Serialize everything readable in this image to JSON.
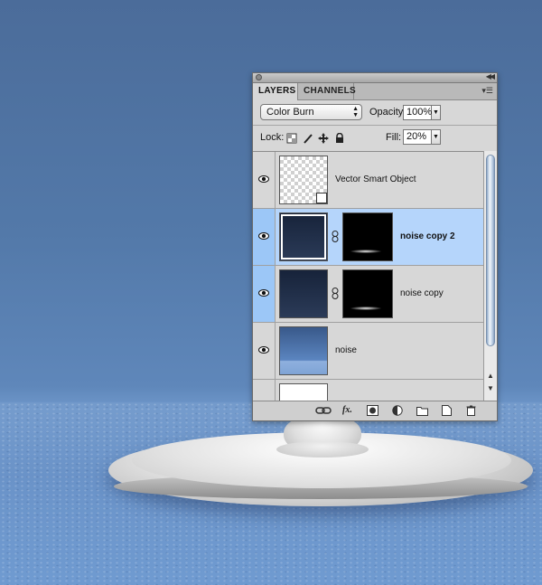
{
  "panel": {
    "tabs": [
      {
        "label": "LAYERS",
        "active": true
      },
      {
        "label": "CHANNELS",
        "active": false
      }
    ],
    "blend_mode": "Color Burn",
    "opacity_label": "Opacity:",
    "opacity_value": "100%",
    "lock_label": "Lock:",
    "fill_label": "Fill:",
    "fill_value": "20%"
  },
  "layers": [
    {
      "name": "Vector Smart Object",
      "visible": true,
      "selected": false,
      "thumbnail": "transparent-checker",
      "smart_object_badge": true
    },
    {
      "name": "noise copy 2",
      "visible": true,
      "selected": true,
      "thumbnail": "dark-gradient",
      "has_mask": true
    },
    {
      "name": "noise copy",
      "visible": true,
      "selected": false,
      "thumbnail": "dark-gradient",
      "has_mask": true
    },
    {
      "name": "noise",
      "visible": true,
      "selected": false,
      "thumbnail": "blue-gradient"
    },
    {
      "name": "",
      "visible": true,
      "selected": false,
      "thumbnail": "white"
    }
  ],
  "bottom_icons": [
    "link-layers-icon",
    "fx-icon",
    "add-mask-icon",
    "adjustment-layer-icon",
    "new-group-icon",
    "new-layer-icon",
    "trash-icon"
  ],
  "colors": {
    "selected_row": "#b5d5fb",
    "panel_bg": "#d7d7d7",
    "background_blue": "#5379a9"
  }
}
